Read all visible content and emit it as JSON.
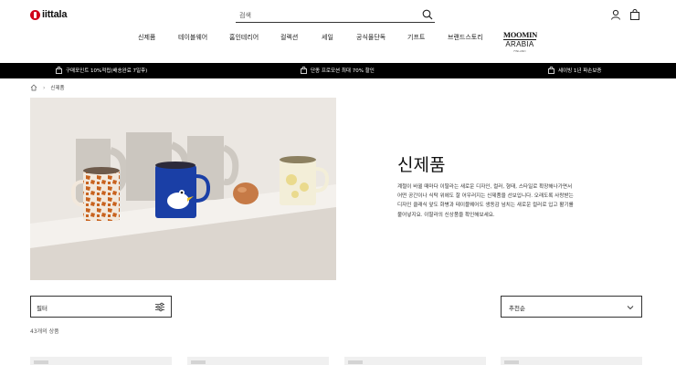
{
  "brand": {
    "name": "iittala"
  },
  "search": {
    "placeholder": "검색"
  },
  "nav": {
    "items": [
      "신제품",
      "테이블웨어",
      "홈인테리어",
      "컬렉션",
      "세일",
      "공식몰단독",
      "기프트",
      "브랜드스토리"
    ],
    "moomin": {
      "top": "MOOMIN",
      "middle": "ARABIA",
      "sub": "FINLAND"
    }
  },
  "promo": {
    "items": [
      "구매포인트 10%적립(배송완료 7일후)",
      "단종 프로모션 최대 70% 할인",
      "세이빙 1년 파손보증"
    ]
  },
  "breadcrumb": {
    "current": "신제품"
  },
  "hero": {
    "title": "신제품",
    "description": "계절이 바뀔 때마다 이딸라는 새로운 디자인, 컬러, 형태, 스타일로 확장해나가면서 어떤 공간이나 식탁 위에도 잘 어우러지는 신제품을 선보입니다. 오래도록 사랑받는 디자인 클래식 앞도 화병과 테이블웨어도 생동감 넘치는 새로운 컬러로 입고 활기를 불어넣지요. 이딸라의 신상품을 확인해보세요."
  },
  "filter": {
    "label": "필터"
  },
  "sort": {
    "label": "추천순"
  },
  "results": {
    "count": "43개의 상품"
  },
  "colors": {
    "accent": "#d0021b",
    "bar": "#000000"
  },
  "icons": [
    "search-icon",
    "user-icon",
    "cart-icon",
    "bag-icon",
    "home-icon",
    "filter-icon",
    "chevron-down-icon"
  ]
}
